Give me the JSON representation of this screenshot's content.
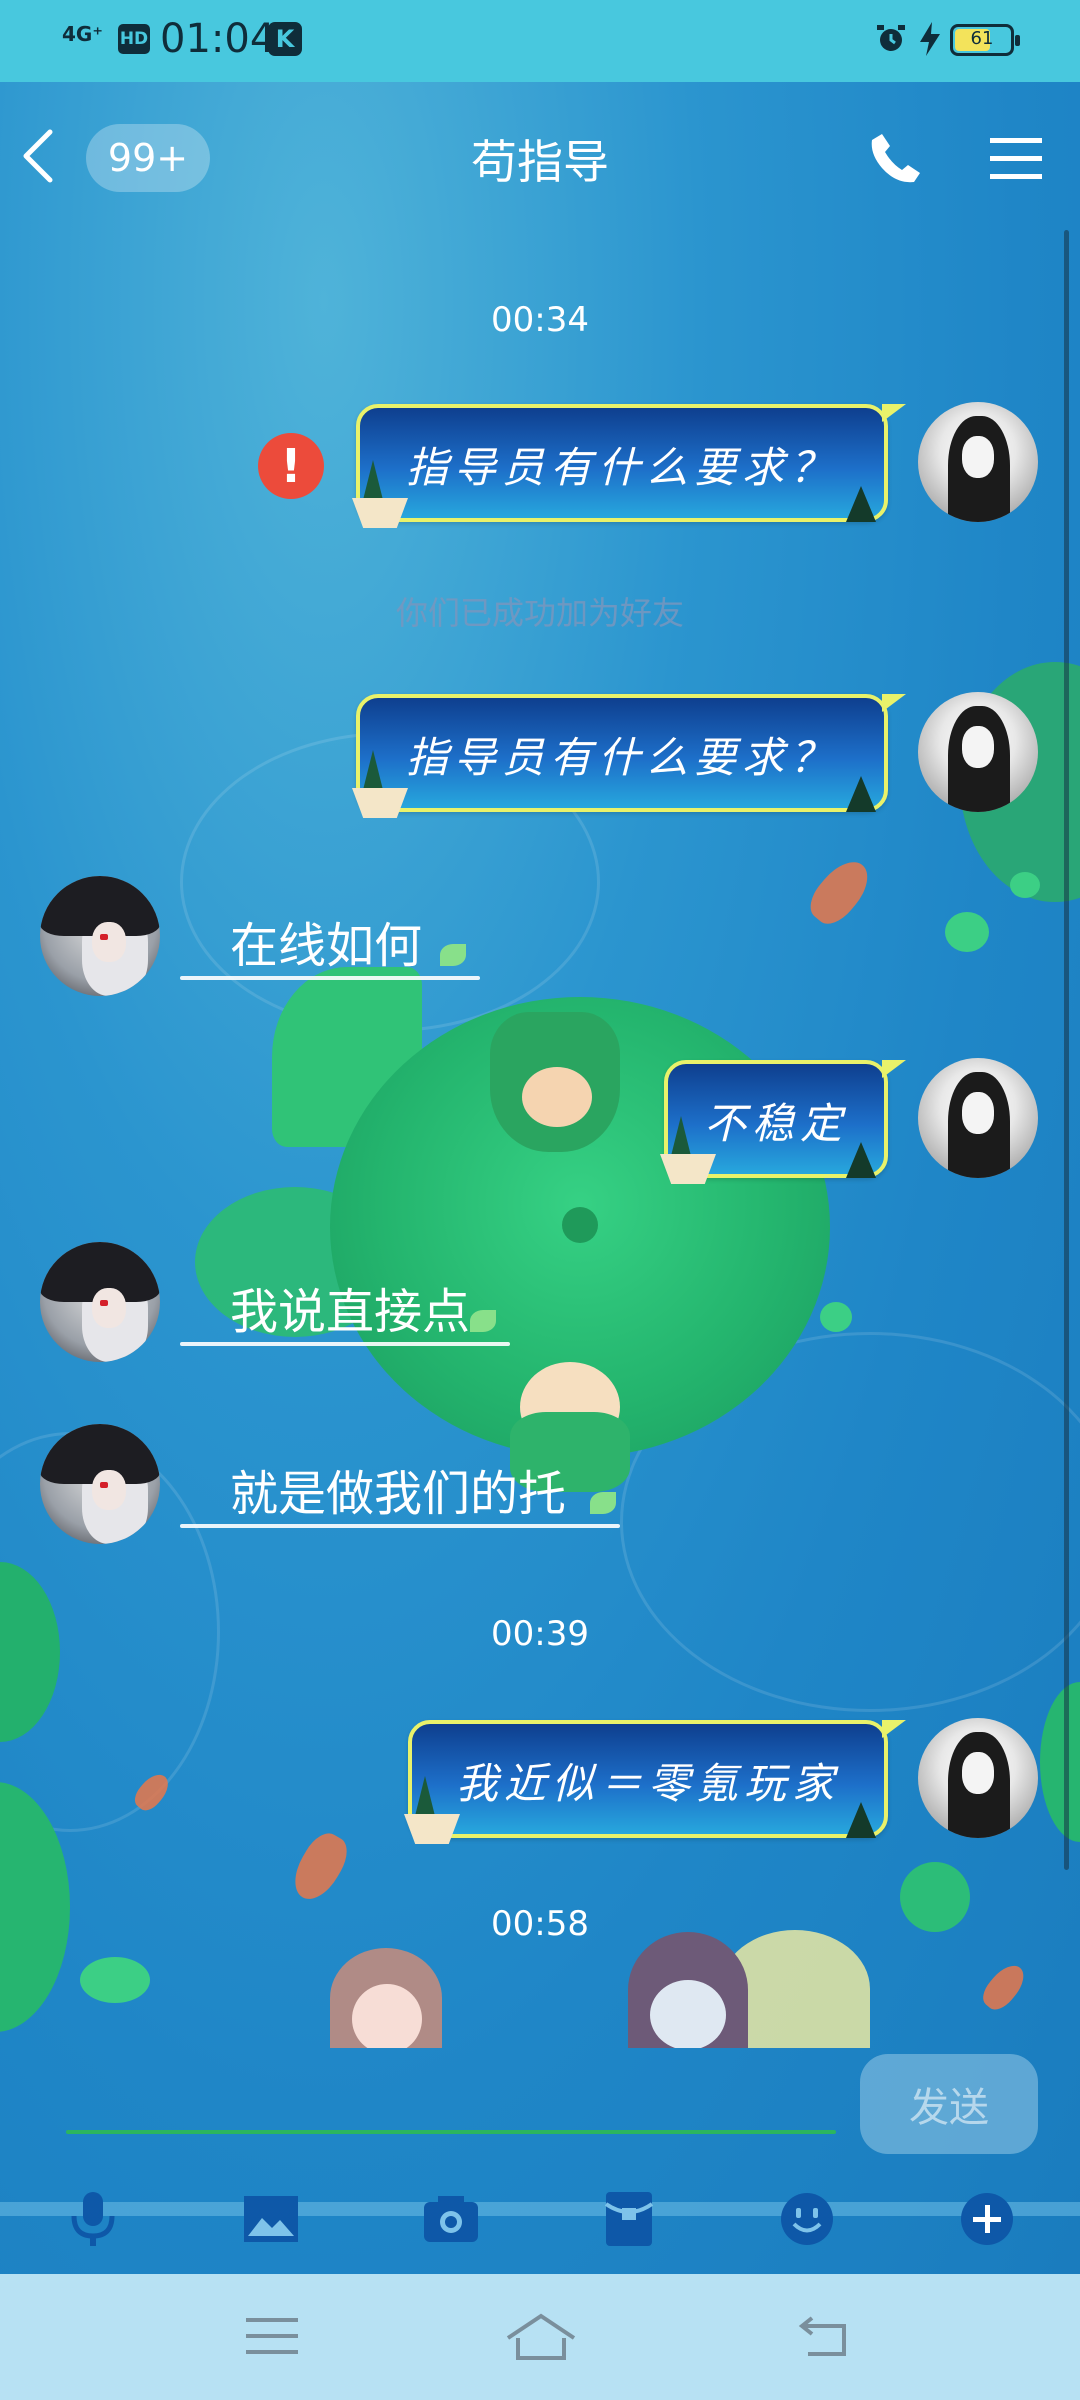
{
  "status_bar": {
    "network": "4G⁺",
    "hd": "HD",
    "time": "01:04",
    "k_badge": "K",
    "battery_level": "61",
    "battery_fraction": 0.61,
    "icons": [
      "signal-icon",
      "hd-icon",
      "k-app-icon",
      "alarm-icon",
      "charging-icon",
      "battery-icon"
    ]
  },
  "header": {
    "back_icon": "chevron-left-icon",
    "unread_count": "99+",
    "title": "苟指导",
    "call_icon": "phone-icon",
    "menu_icon": "hamburger-icon"
  },
  "messages": [
    {
      "type": "timestamp",
      "text": "00:34"
    },
    {
      "type": "outgoing",
      "text": "指导员有什么要求？",
      "failed": true
    },
    {
      "type": "system",
      "text": "你们已成功加为好友"
    },
    {
      "type": "outgoing",
      "text": "指导员有什么要求？"
    },
    {
      "type": "incoming",
      "text": "在线如何"
    },
    {
      "type": "outgoing",
      "text": "不稳定"
    },
    {
      "type": "incoming",
      "text": "我说直接点"
    },
    {
      "type": "incoming",
      "text": "就是做我们的托"
    },
    {
      "type": "timestamp",
      "text": "00:39"
    },
    {
      "type": "outgoing",
      "text": "我近似＝零氪玩家"
    },
    {
      "type": "timestamp",
      "text": "00:58"
    }
  ],
  "error_mark": "!",
  "input": {
    "value": "",
    "send_label": "发送"
  },
  "toolbar": {
    "items": [
      "microphone-icon",
      "image-icon",
      "camera-icon",
      "red-packet-icon",
      "emoji-icon",
      "plus-icon"
    ]
  },
  "nav_bar": {
    "items": [
      "recents-icon",
      "home-icon",
      "back-icon"
    ]
  },
  "colors": {
    "status_bar_bg": "#48c8de",
    "bubble_border": "#e9f26a",
    "bubble_top": "#0e3f8f",
    "bubble_bottom": "#27a7dd",
    "error_red": "#ec4b3b",
    "nav_bg": "#b7e1f3",
    "icon_blue": "#0e58a8"
  }
}
